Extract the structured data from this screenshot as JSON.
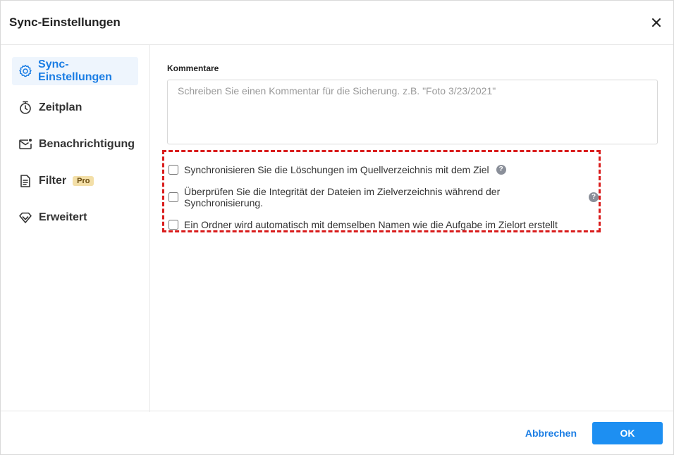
{
  "dialog": {
    "title": "Sync-Einstellungen"
  },
  "sidebar": {
    "items": [
      {
        "label": "Sync-Einstellungen",
        "icon": "gear-icon",
        "active": true
      },
      {
        "label": "Zeitplan",
        "icon": "timer-icon"
      },
      {
        "label": "Benachrichtigung",
        "icon": "mail-icon"
      },
      {
        "label": "Filter",
        "icon": "document-icon",
        "badge": "Pro"
      },
      {
        "label": "Erweitert",
        "icon": "diamond-icon"
      }
    ]
  },
  "main": {
    "comment_label": "Kommentare",
    "comment_placeholder": "Schreiben Sie einen Kommentar für die Sicherung. z.B. \"Foto 3/23/2021\"",
    "options": [
      {
        "label": "Synchronisieren Sie die Löschungen im Quellverzeichnis mit dem Ziel",
        "checked": false,
        "help": true
      },
      {
        "label": "Überprüfen Sie die Integrität der Dateien im Zielverzeichnis während der Synchronisierung.",
        "checked": false,
        "help": true
      },
      {
        "label": "Ein Ordner wird automatisch mit demselben Namen wie die Aufgabe im Zielort erstellt",
        "checked": false,
        "help": false
      }
    ]
  },
  "footer": {
    "cancel_label": "Abbrechen",
    "ok_label": "OK"
  },
  "colors": {
    "accent": "#1a7de4",
    "highlight_border": "#d91c1c",
    "pro_badge_bg": "#f3dfa8"
  }
}
